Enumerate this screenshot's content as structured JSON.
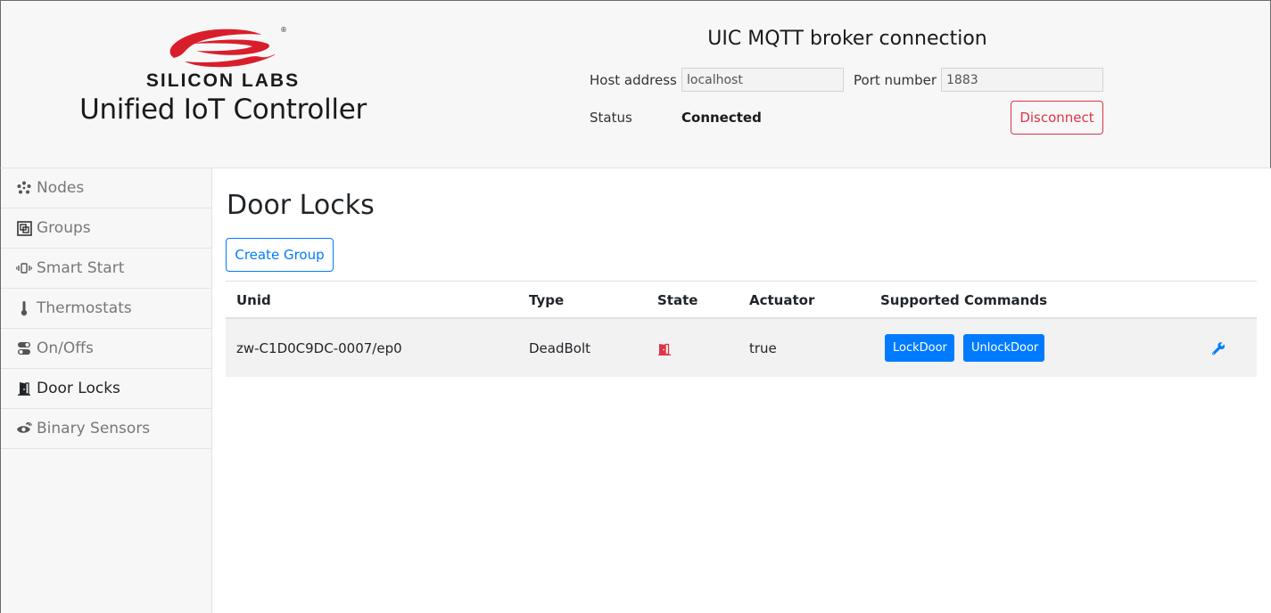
{
  "brand": {
    "name": "SILICON LABS",
    "app_title": "Unified IoT Controller",
    "logo_color": "#d91e2b"
  },
  "broker": {
    "title": "UIC MQTT broker connection",
    "host_label": "Host address",
    "host_value": "localhost",
    "port_label": "Port number",
    "port_value": "1883",
    "status_label": "Status",
    "status_value": "Connected",
    "disconnect_label": "Disconnect"
  },
  "sidebar": {
    "items": [
      {
        "label": "Nodes",
        "icon": "nodes-icon"
      },
      {
        "label": "Groups",
        "icon": "groups-icon"
      },
      {
        "label": "Smart Start",
        "icon": "smart-start-icon"
      },
      {
        "label": "Thermostats",
        "icon": "thermometer-icon"
      },
      {
        "label": "On/Offs",
        "icon": "toggle-icon"
      },
      {
        "label": "Door Locks",
        "icon": "door-icon"
      },
      {
        "label": "Binary Sensors",
        "icon": "sensor-icon"
      }
    ],
    "active_index": 5
  },
  "main": {
    "title": "Door Locks",
    "create_group_label": "Create Group",
    "table": {
      "headers": [
        "Unid",
        "Type",
        "State",
        "Actuator",
        "Supported Commands"
      ],
      "rows": [
        {
          "unid": "zw-C1D0C9DC-0007/ep0",
          "type": "DeadBolt",
          "state_icon": "door-open-icon",
          "actuator": "true",
          "commands": [
            "LockDoor",
            "UnlockDoor"
          ],
          "action_icon": "wrench-icon"
        }
      ]
    }
  },
  "colors": {
    "accent": "#007bff",
    "danger": "#dc3545",
    "state_red": "#dc3545"
  }
}
